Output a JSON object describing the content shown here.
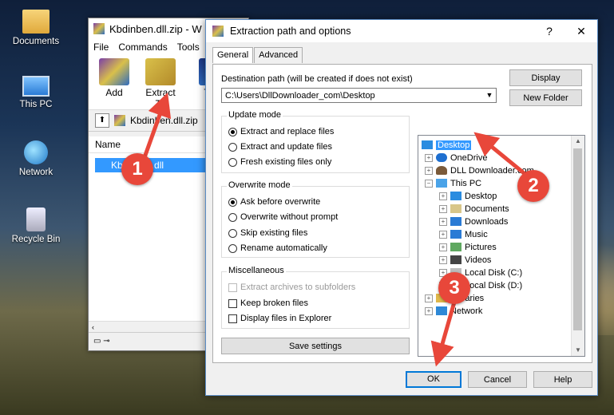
{
  "desktop": {
    "icons": [
      {
        "label": "Documents"
      },
      {
        "label": "This PC"
      },
      {
        "label": "Network"
      },
      {
        "label": "Recycle Bin"
      }
    ]
  },
  "winrar": {
    "title": "Kbdinben.dll.zip - W",
    "menu": [
      "File",
      "Commands",
      "Tools"
    ],
    "toolbar": {
      "add": "Add",
      "extract_to": "Extract To",
      "partial": "T"
    },
    "path": "Kbdinben.dll.zip",
    "column_name": "Name",
    "file": "Kbdinben.dll"
  },
  "dialog": {
    "title": "Extraction path and options",
    "help_glyph": "?",
    "close_glyph": "✕",
    "tabs": [
      "General",
      "Advanced"
    ],
    "dest_label": "Destination path (will be created if does not exist)",
    "dest_value": "C:\\Users\\DllDownloader_com\\Desktop",
    "display_btn": "Display",
    "new_folder_btn": "New Folder",
    "update_mode": {
      "title": "Update mode",
      "options": [
        "Extract and replace files",
        "Extract and update files",
        "Fresh existing files only"
      ],
      "selected": 0
    },
    "overwrite_mode": {
      "title": "Overwrite mode",
      "options": [
        "Ask before overwrite",
        "Overwrite without prompt",
        "Skip existing files",
        "Rename automatically"
      ],
      "selected": 0
    },
    "misc": {
      "title": "Miscellaneous",
      "options": [
        "Extract archives to subfolders",
        "Keep broken files",
        "Display files in Explorer"
      ]
    },
    "save_settings": "Save settings",
    "tree": {
      "desktop": "Desktop",
      "onedrive": "OneDrive",
      "dll": "DLL Downloader.com",
      "thispc": "This PC",
      "pc_children": [
        "Desktop",
        "Documents",
        "Downloads",
        "Music",
        "Pictures",
        "Videos",
        "Local Disk (C:)",
        "Local Disk (D:)"
      ],
      "libraries": "Libraries",
      "network": "Network"
    },
    "ok": "OK",
    "cancel": "Cancel",
    "help": "Help"
  },
  "annotations": [
    "1",
    "2",
    "3"
  ],
  "colors": {
    "accent": "#3399ff",
    "marker": "#e8473a"
  }
}
